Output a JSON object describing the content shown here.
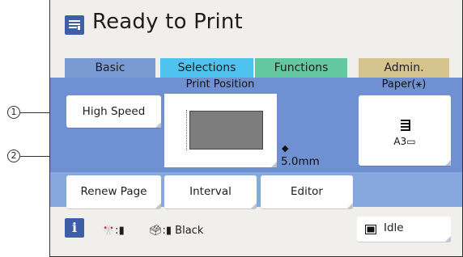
{
  "callouts": {
    "one": "1",
    "two": "2"
  },
  "title": {
    "text": "Ready to Print",
    "icon": "document-list-icon"
  },
  "tabs": [
    {
      "label": "Basic",
      "color": "#7a9ad3"
    },
    {
      "label": "Selections",
      "color": "#4fc3ef"
    },
    {
      "label": "Functions",
      "color": "#64c8a0"
    },
    {
      "label": "Admin.",
      "color": "#d6c48f"
    }
  ],
  "basic": {
    "print_position_label": "Print Position",
    "paper_label": "Paper(⚹)",
    "high_speed_label": "High Speed",
    "offset_icon": "◆",
    "offset_value": "5.0mm",
    "paper_size": "A3▭",
    "renew_page_label": "Renew Page",
    "interval_label": "Interval",
    "editor_label": "Editor"
  },
  "status": {
    "info_label": "i",
    "drum": "🎌:▮",
    "ink": "🗳:▮ Black",
    "idle_label": "Idle"
  },
  "colors": {
    "panel": "#6f91d2",
    "panel_lower": "#87a7df",
    "accent": "#3d5fa7",
    "screen_bg": "#f0efec"
  }
}
